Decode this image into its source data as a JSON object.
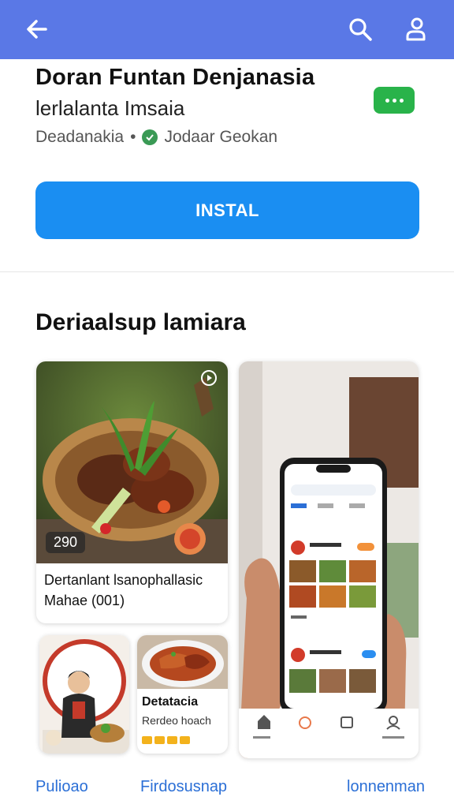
{
  "header": {
    "back_icon": "back-arrow-icon",
    "search_icon": "search-icon",
    "profile_icon": "profile-icon"
  },
  "app": {
    "title": "Doran Funtan Denjanasia",
    "subtitle": "lerlalanta Imsaia",
    "meta_left": "Deadanakia",
    "meta_dot": "•",
    "meta_right": "Jodaar Geokan",
    "install_label": "INSTAL",
    "accent_color": "#1a8ef2",
    "header_color": "#5a78e6",
    "chip_color": "#29b34a"
  },
  "section": {
    "title": "Deriaalsup lamiara"
  },
  "cards": {
    "main": {
      "rating": "290",
      "caption_line1": "Dertanlant lsanophallasic",
      "caption_line2": "Mahae (001)"
    },
    "small2": {
      "title": "Detatacia",
      "subtitle": "Rerdeo hoach"
    }
  },
  "bottom_links": [
    "Pulioao",
    "Firdosusnap",
    "lonnenman"
  ]
}
